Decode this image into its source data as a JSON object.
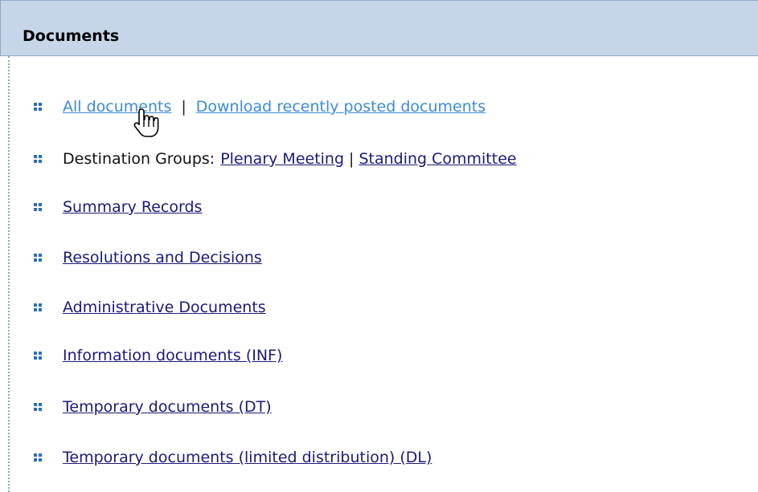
{
  "panel": {
    "title": "Documents"
  },
  "row1": {
    "all_documents": "All documents",
    "separator": "|",
    "download_recent": "Download recently posted documents"
  },
  "row2": {
    "label": "Destination Groups:",
    "plenary": "Plenary Meeting",
    "separator": "|",
    "standing": "Standing Committee"
  },
  "links": [
    "Summary Records",
    "Resolutions and Decisions",
    "Administrative Documents",
    "Information documents (INF)",
    "Temporary documents (DT)",
    "Temporary documents (limited distribution) (DL)"
  ],
  "icons": {
    "bullet": "grid-bullet-icon",
    "cursor": "hand-pointer-icon"
  },
  "colors": {
    "header_background": "#c6d6e8",
    "header_border": "#8fa6c5",
    "bullet": "#2b6fb2",
    "link": "#1a1a7a",
    "link_highlight": "#3b8bd9"
  }
}
